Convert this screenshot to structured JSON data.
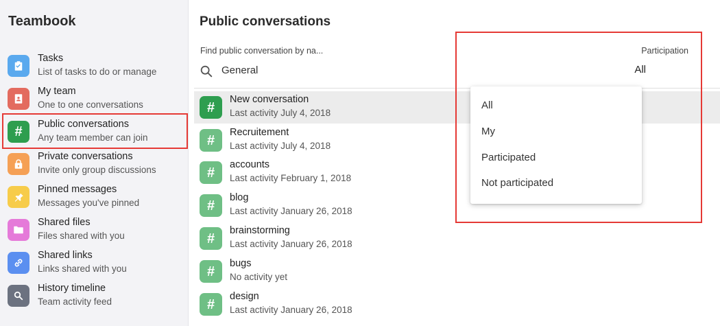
{
  "sidebar": {
    "app_title": "Teambook",
    "items": [
      {
        "label": "Tasks",
        "sub": "List of tasks to do or manage",
        "icon": "clipboard-check-icon",
        "color": "#5aa9ee"
      },
      {
        "label": "My team",
        "sub": "One to one conversations",
        "icon": "contacts-book-icon",
        "color": "#e36b5f"
      },
      {
        "label": "Public conversations",
        "sub": "Any team member can join",
        "icon": "hash-icon",
        "color": "#2e9e4f"
      },
      {
        "label": "Private conversations",
        "sub": "Invite only group discussions",
        "icon": "lock-icon",
        "color": "#f5a055"
      },
      {
        "label": "Pinned messages",
        "sub": "Messages you've pinned",
        "icon": "pin-icon",
        "color": "#f7cc4a"
      },
      {
        "label": "Shared files",
        "sub": "Files shared with you",
        "icon": "folder-icon",
        "color": "#e57ad9"
      },
      {
        "label": "Shared links",
        "sub": "Links shared with you",
        "icon": "link-icon",
        "color": "#5b8ff0"
      },
      {
        "label": "History timeline",
        "sub": "Team activity feed",
        "icon": "search-history-icon",
        "color": "#6c7280"
      }
    ]
  },
  "main": {
    "title": "Public conversations",
    "search": {
      "label": "Find public conversation by na...",
      "value": "General"
    },
    "participation": {
      "label": "Participation",
      "value": "All"
    },
    "conversations": [
      {
        "name": "New conversation",
        "sub": "Last activity July 4, 2018"
      },
      {
        "name": "Recruitement",
        "sub": "Last activity July 4, 2018"
      },
      {
        "name": "accounts",
        "sub": "Last activity February 1, 2018"
      },
      {
        "name": "blog",
        "sub": "Last activity January 26, 2018"
      },
      {
        "name": "brainstorming",
        "sub": "Last activity January 26, 2018"
      },
      {
        "name": "bugs",
        "sub": "No activity yet"
      },
      {
        "name": "design",
        "sub": "Last activity January 26, 2018"
      }
    ],
    "dropdown_options": [
      "All",
      "My",
      "Participated",
      "Not participated"
    ]
  },
  "colors": {
    "accent_green": "#2e9e4f",
    "hash_green": "#6fbf85",
    "highlight_red": "#e53935"
  }
}
